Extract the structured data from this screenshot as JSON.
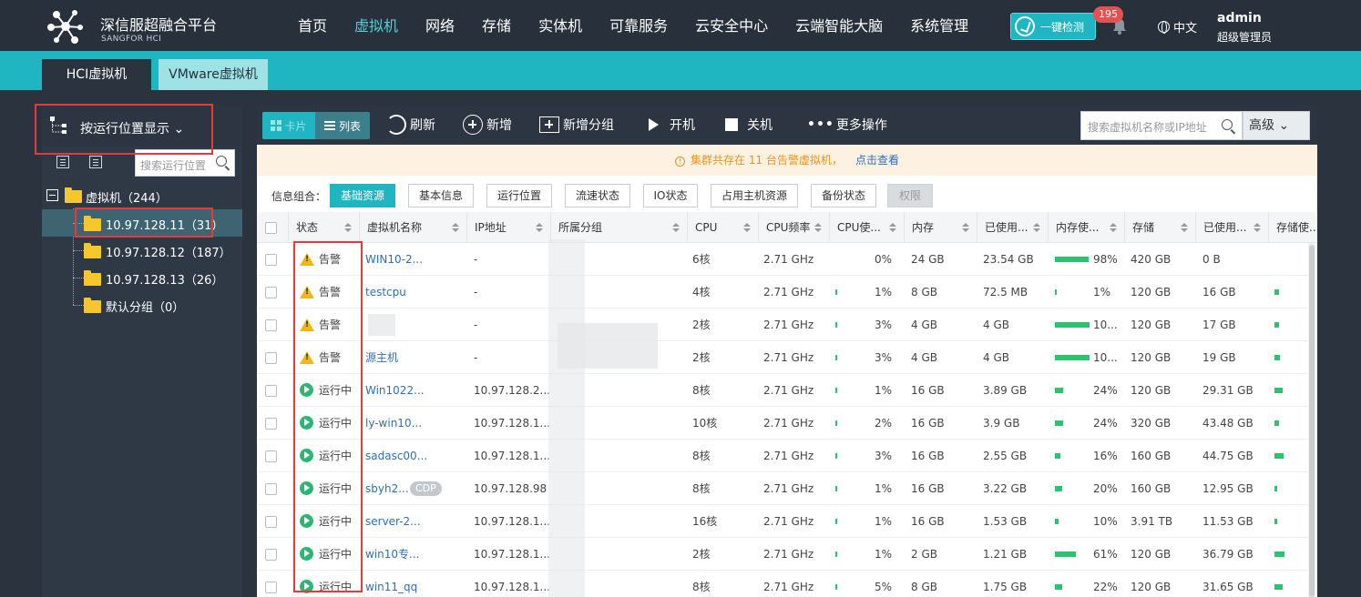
{
  "brand": {
    "name_cn": "深信服超融合平台",
    "name_en": "SANGFOR HCI"
  },
  "nav": [
    {
      "label": "首页",
      "active": false
    },
    {
      "label": "虚拟机",
      "active": true
    },
    {
      "label": "网络",
      "active": false
    },
    {
      "label": "存储",
      "active": false
    },
    {
      "label": "实体机",
      "active": false
    },
    {
      "label": "可靠服务",
      "active": false
    },
    {
      "label": "云安全中心",
      "active": false
    },
    {
      "label": "云端智能大脑",
      "active": false
    },
    {
      "label": "系统管理",
      "active": false
    }
  ],
  "header": {
    "check_button": "一键检测",
    "notification_count": "195",
    "language": "中文",
    "user_name": "admin",
    "user_role": "超级管理员"
  },
  "subtabs": [
    "HCI虚拟机",
    "VMware虚拟机"
  ],
  "left": {
    "view_mode": "按运行位置显示",
    "search_placeholder": "搜索运行位置",
    "tree": [
      {
        "label": "虚拟机（244）"
      },
      {
        "label": "10.97.128.11（31）"
      },
      {
        "label": "10.97.128.12（187）"
      },
      {
        "label": "10.97.128.13（26）"
      },
      {
        "label": "默认分组（0）"
      }
    ]
  },
  "toolbar": {
    "card": "卡片",
    "list": "列表",
    "refresh": "刷新",
    "add": "新增",
    "add_group": "新增分组",
    "power_on": "开机",
    "power_off": "关机",
    "more": "更多操作",
    "search_placeholder": "搜索虚拟机名称或IP地址",
    "advanced": "高级"
  },
  "alert": {
    "text": "集群共存在 11 台告警虚拟机，",
    "link": "点击查看"
  },
  "filters": {
    "label": "信息组合：",
    "chips": [
      "基础资源",
      "基本信息",
      "运行位置",
      "流速状态",
      "IO状态",
      "占用主机资源",
      "备份状态",
      "权限"
    ]
  },
  "table": {
    "columns": [
      "状态",
      "虚拟机名称",
      "IP地址",
      "所属分组",
      "CPU",
      "CPU频率",
      "CPU使...",
      "内存",
      "已使用...",
      "内存使...",
      "存储",
      "已使用...",
      "存储使..."
    ],
    "rows": [
      {
        "status": "告警",
        "name": "WIN10-2...",
        "ip": "-",
        "cpu": "6核",
        "freq": "2.71 GHz",
        "cpu_pct": "0%",
        "cpu_use": 0,
        "mem": "24 GB",
        "mem_used": "23.54 GB",
        "mem_pct": "98%",
        "mem_use": 0.98,
        "storage": "420 GB",
        "st_used": "0 B",
        "st_use": 0
      },
      {
        "status": "告警",
        "name": "testcpu",
        "ip": "-",
        "cpu": "4核",
        "freq": "2.71 GHz",
        "cpu_pct": "1%",
        "cpu_use": 0.01,
        "mem": "8 GB",
        "mem_used": "72.5 MB",
        "mem_pct": "1%",
        "mem_use": 0.01,
        "storage": "120 GB",
        "st_used": "16 GB",
        "st_use": 0.13
      },
      {
        "status": "告警",
        "name": "",
        "ip": "-",
        "cpu": "2核",
        "freq": "2.71 GHz",
        "cpu_pct": "3%",
        "cpu_use": 0.03,
        "mem": "4 GB",
        "mem_used": "4 GB",
        "mem_pct": "10...",
        "mem_use": 1.0,
        "storage": "120 GB",
        "st_used": "17 GB",
        "st_use": 0.14
      },
      {
        "status": "告警",
        "name": "源主机",
        "ip": "-",
        "cpu": "2核",
        "freq": "2.71 GHz",
        "cpu_pct": "3%",
        "cpu_use": 0.03,
        "mem": "4 GB",
        "mem_used": "4 GB",
        "mem_pct": "10...",
        "mem_use": 1.0,
        "storage": "120 GB",
        "st_used": "19 GB",
        "st_use": 0.16
      },
      {
        "status": "运行中",
        "name": "Win1022...",
        "ip": "10.97.128.2...",
        "cpu": "8核",
        "freq": "2.71 GHz",
        "cpu_pct": "1%",
        "cpu_use": 0.01,
        "mem": "16 GB",
        "mem_used": "3.89 GB",
        "mem_pct": "24%",
        "mem_use": 0.24,
        "storage": "120 GB",
        "st_used": "29.31 GB",
        "st_use": 0.24
      },
      {
        "status": "运行中",
        "name": "ly-win10...",
        "ip": "10.97.128.1...",
        "cpu": "10核",
        "freq": "2.71 GHz",
        "cpu_pct": "2%",
        "cpu_use": 0.02,
        "mem": "16 GB",
        "mem_used": "3.9 GB",
        "mem_pct": "24%",
        "mem_use": 0.24,
        "storage": "320 GB",
        "st_used": "43.48 GB",
        "st_use": 0.14
      },
      {
        "status": "运行中",
        "name": "sadasc00...",
        "ip": "10.97.128.1...",
        "cpu": "8核",
        "freq": "2.71 GHz",
        "cpu_pct": "3%",
        "cpu_use": 0.03,
        "mem": "16 GB",
        "mem_used": "2.55 GB",
        "mem_pct": "16%",
        "mem_use": 0.16,
        "storage": "160 GB",
        "st_used": "44.75 GB",
        "st_use": 0.28
      },
      {
        "status": "运行中",
        "name": "sbyh2...",
        "ip": "10.97.128.98",
        "cpu": "8核",
        "freq": "2.71 GHz",
        "cpu_pct": "1%",
        "cpu_use": 0.01,
        "mem": "16 GB",
        "mem_used": "3.22 GB",
        "mem_pct": "20%",
        "mem_use": 0.2,
        "storage": "160 GB",
        "st_used": "12.95 GB",
        "st_use": 0.08,
        "tag": "CDP"
      },
      {
        "status": "运行中",
        "name": "server-2...",
        "ip": "10.97.128.1...",
        "cpu": "16核",
        "freq": "2.71 GHz",
        "cpu_pct": "1%",
        "cpu_use": 0.01,
        "mem": "16 GB",
        "mem_used": "1.53 GB",
        "mem_pct": "10%",
        "mem_use": 0.1,
        "storage": "3.91 TB",
        "st_used": "11.53 GB",
        "st_use": 0.01
      },
      {
        "status": "运行中",
        "name": "win10专...",
        "ip": "10.97.128.1...",
        "cpu": "2核",
        "freq": "2.71 GHz",
        "cpu_pct": "1%",
        "cpu_use": 0.01,
        "mem": "2 GB",
        "mem_used": "1.21 GB",
        "mem_pct": "61%",
        "mem_use": 0.61,
        "storage": "120 GB",
        "st_used": "36.79 GB",
        "st_use": 0.31
      },
      {
        "status": "运行中",
        "name": "win11_qq",
        "ip": "10.97.128.1...",
        "cpu": "8核",
        "freq": "2.71 GHz",
        "cpu_pct": "5%",
        "cpu_use": 0.05,
        "mem": "8 GB",
        "mem_used": "1.75 GB",
        "mem_pct": "22%",
        "mem_use": 0.22,
        "storage": "120 GB",
        "st_used": "31.65 GB",
        "st_use": 0.26
      }
    ]
  }
}
